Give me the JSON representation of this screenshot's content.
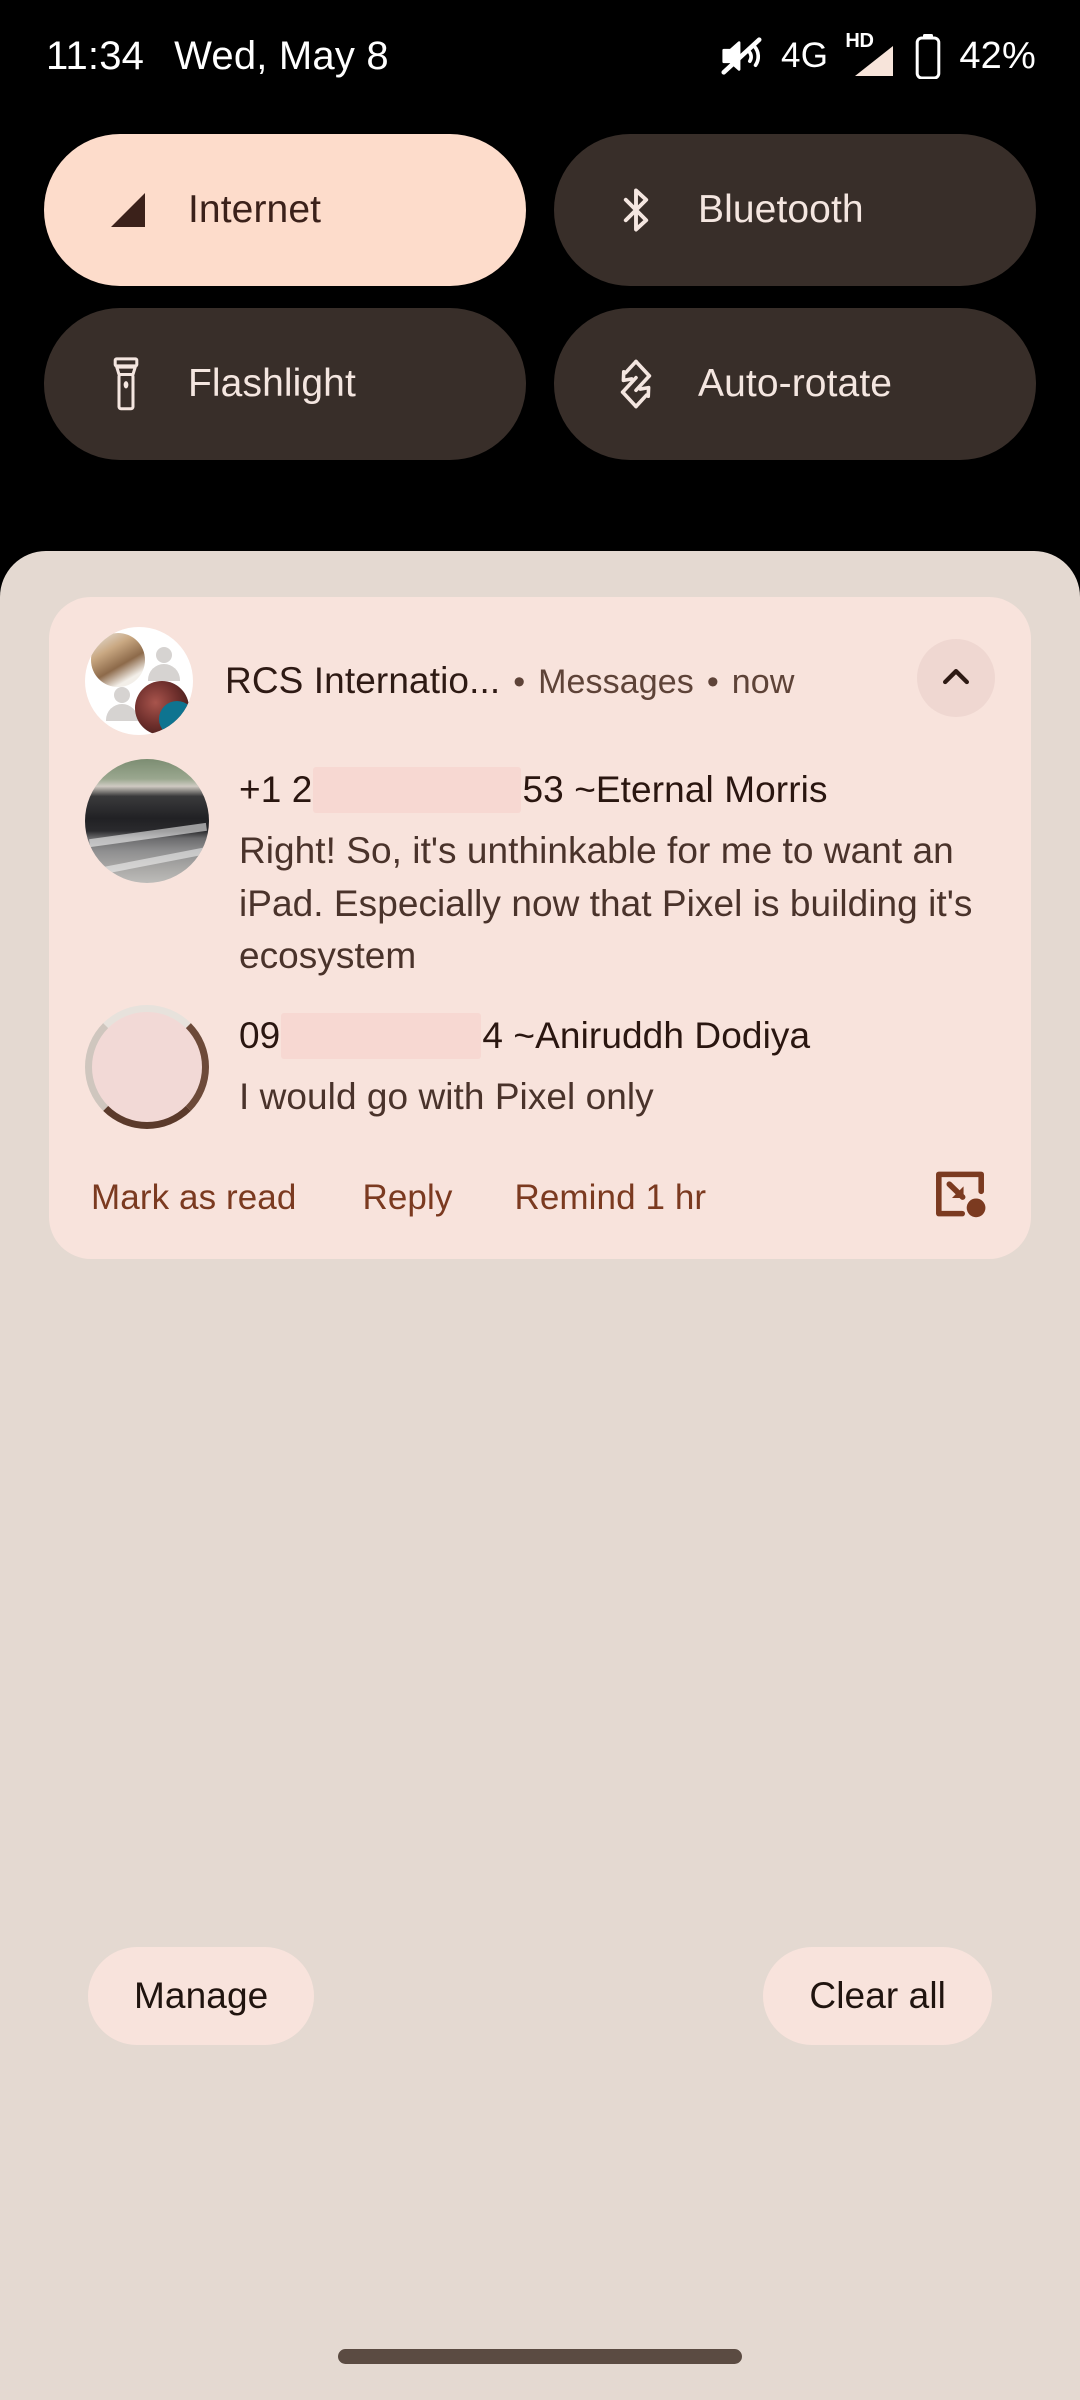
{
  "status_bar": {
    "clock": "11:34",
    "date": "Wed, May 8",
    "network_type": "4G",
    "hd_label": "HD",
    "battery_percent": "42%",
    "icons": {
      "ringer": "volume-off-icon",
      "signal": "signal-bars-icon",
      "battery": "battery-icon"
    }
  },
  "quick_settings": {
    "tiles": [
      {
        "label": "Internet",
        "icon": "signal-triangle-icon",
        "active": true
      },
      {
        "label": "Bluetooth",
        "icon": "bluetooth-icon",
        "active": false
      },
      {
        "label": "Flashlight",
        "icon": "flashlight-icon",
        "active": false
      },
      {
        "label": "Auto-rotate",
        "icon": "auto-rotate-icon",
        "active": false
      }
    ]
  },
  "notification": {
    "app_title": "RCS Internatio...",
    "separator": "•",
    "app_name": "Messages",
    "time": "now",
    "collapse_icon": "chevron-up-icon",
    "messages": [
      {
        "sender_prefix": "+1 2",
        "sender_suffix": "53 ~Eternal Morris",
        "text": "Right! So, it's unthinkable for me to want an iPad. Especially now that Pixel is building it's ecosystem",
        "avatar": "car-photo-avatar"
      },
      {
        "sender_prefix": "09",
        "sender_suffix": "4 ~Aniruddh Dodiya",
        "text": "I would go with Pixel only",
        "avatar": "ring-photo-avatar"
      }
    ],
    "actions": [
      {
        "label": "Mark as read"
      },
      {
        "label": "Reply"
      },
      {
        "label": "Remind 1 hr"
      }
    ],
    "bubble_icon": "bubble-icon"
  },
  "footer": {
    "manage_label": "Manage",
    "clear_all_label": "Clear all"
  },
  "colors": {
    "status_bar_bg": "#000000",
    "shade_bg": "#E4D9D1",
    "card_bg": "#F8E3DC",
    "tile_active_bg": "#FDDCCB",
    "tile_inactive_bg": "#382E29",
    "accent_action": "#7B3A20",
    "nav_pill": "#5B4B42"
  }
}
